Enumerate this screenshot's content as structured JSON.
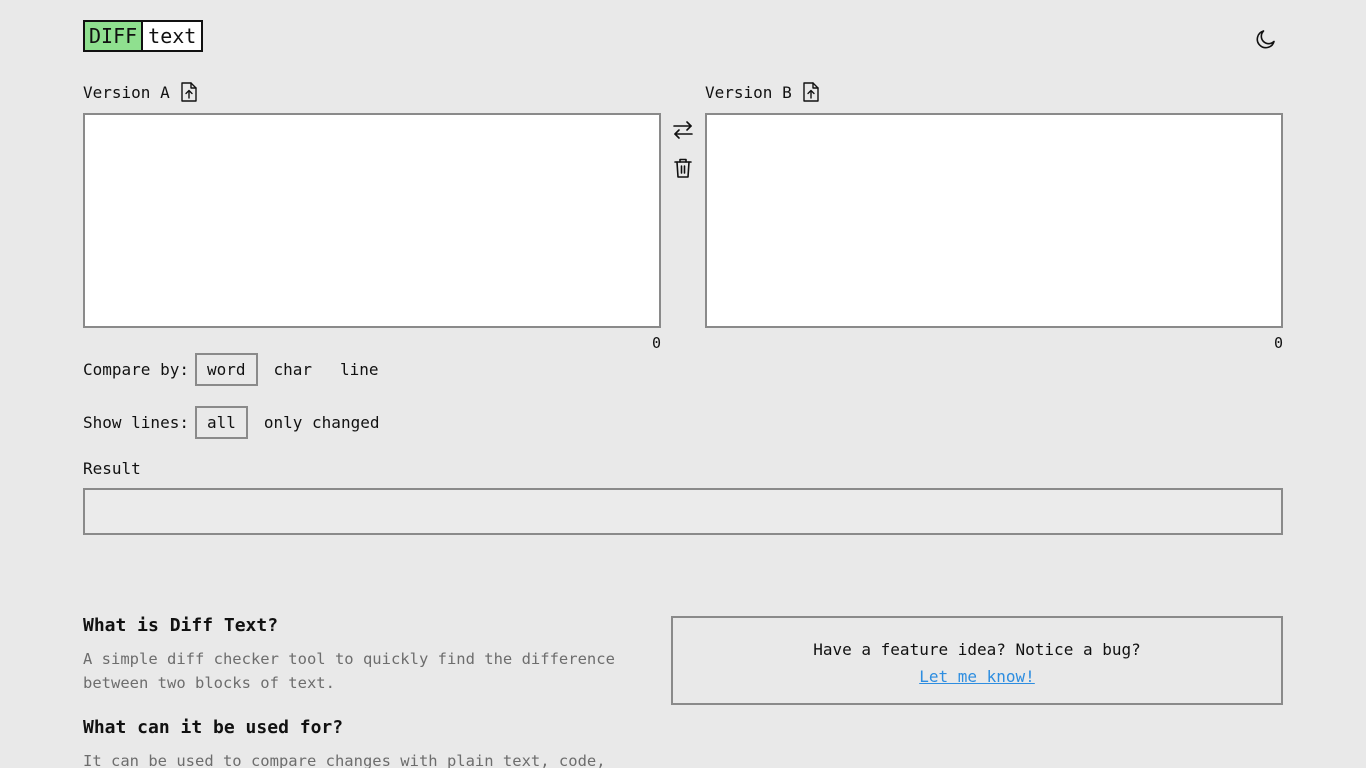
{
  "header": {
    "logo_diff": "DIFF",
    "logo_text": "text",
    "theme_icon": "moon-icon"
  },
  "panels": {
    "a": {
      "label": "Version A",
      "upload_icon": "file-upload-icon",
      "value": "",
      "count": "0"
    },
    "b": {
      "label": "Version B",
      "upload_icon": "file-upload-icon",
      "value": "",
      "count": "0"
    }
  },
  "actions": {
    "swap_icon": "swap-arrows-icon",
    "clear_icon": "trash-icon"
  },
  "compare_by": {
    "label": "Compare by:",
    "options": [
      "word",
      "char",
      "line"
    ],
    "selected": "word"
  },
  "show_lines": {
    "label": "Show lines:",
    "options": [
      "all",
      "only changed"
    ],
    "selected": "all"
  },
  "result": {
    "label": "Result"
  },
  "faq": {
    "q1": "What is Diff Text?",
    "a1": "A simple diff checker tool to quickly find the difference between two blocks of text.",
    "q2": "What can it be used for?",
    "a2": "It can be used to compare changes with plain text, code,"
  },
  "feedback": {
    "text": "Have a feature idea? Notice a bug?",
    "link": "Let me know!"
  },
  "colors": {
    "background": "#e9e9e9",
    "logo_accent": "#8fe08f",
    "link": "#2d8de0",
    "border": "#8a8a8a"
  }
}
